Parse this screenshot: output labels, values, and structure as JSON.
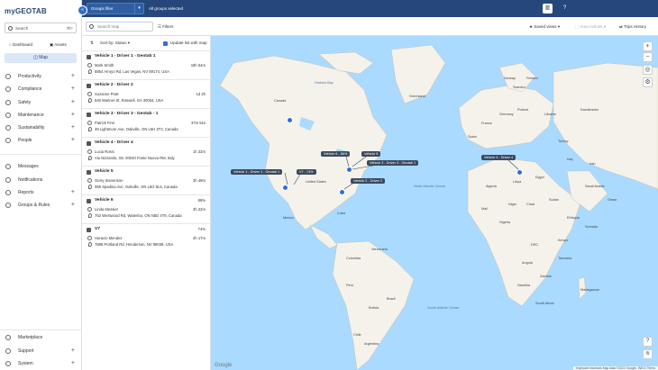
{
  "app": {
    "logo_my": "my",
    "logo_geotab": "GEOTAB"
  },
  "sidebar": {
    "search_placeholder": "Search",
    "search_shortcut": "⌘F",
    "dashboard": "Dashboard",
    "assets": "Assets",
    "map": "Map",
    "nav": [
      "Productivity",
      "Compliance",
      "Safety",
      "Maintenance",
      "Sustainability",
      "People"
    ],
    "nav2": [
      "Messages",
      "Notifications",
      "Reports",
      "Groups & Rules"
    ],
    "bottom": [
      "Marketplace",
      "Support",
      "System"
    ]
  },
  "topbar": {
    "group_filter": "Groups filter",
    "all_groups": "All groups selected"
  },
  "toolbar": {
    "search_placeholder": "Search map",
    "filters": "Filters",
    "saved_views": "Saved views",
    "area_actions": "Area Actions",
    "trips_history": "Trips History"
  },
  "list": {
    "sort_by": "Sort by:",
    "sort_value": "Status",
    "update_label": "Update list with map",
    "vehicles": [
      {
        "name": "Vehicle 1 - Driver 1 - Geotab 1",
        "driver": "Mark Smith",
        "address": "6854 Arroyo Rd, Las Vegas, NV 89174, USA",
        "time": "18h 54m"
      },
      {
        "name": "Vehicle 2 - Driver 2",
        "driver": "Suzanne Pratt",
        "address": "540 Mariner St, Roswell, GA 30054, USA",
        "time": "1d 2h"
      },
      {
        "name": "Vehicle 3 - Driver 3 - Geotab - 1",
        "driver": "Patrick Finn",
        "address": "39 Lightmore Ave, Oakville, ON L6H 4T3, Canada",
        "time": "37m 51s"
      },
      {
        "name": "Vehicle 4 - Driver 4",
        "driver": "Lucia Rossi",
        "address": "Via Nizzanito, Str, 00040 Fonte Nuova RM, Italy",
        "time": "1h 32m"
      },
      {
        "name": "Vehicle 5",
        "driver": "Gerry Stevenson",
        "address": "066 Spadina Ave, Oakville, ON L6G 5L5, Canada",
        "time": "3h 49m"
      },
      {
        "name": "Vehicle 6",
        "driver": "Linda Messier",
        "address": "753 Westwood Rd, Waterloo, ON N5D 4T9, Canada",
        "time": "3h 22m",
        "pct": "86%"
      },
      {
        "name": "V7",
        "driver": "Horacio Mendez",
        "address": "7898 Portland Rd, Henderson, NV 89039, USA",
        "time": "4h 17m",
        "pct": "74%"
      }
    ]
  },
  "map": {
    "labels": [
      "Vehicle 6 - 86%",
      "Vehicle 5",
      "Vehicle 1 - Driver 1 - Geotab 1",
      "V7 - 74%",
      "Vehicle 3 - Driver 3 - Geotab 1",
      "Vehicle 2 - Driver 2",
      "Vehicle 4 - Driver 4"
    ],
    "places": [
      "Greenland",
      "Canada",
      "United States",
      "Mexico",
      "Venezuela",
      "Colombia",
      "Peru",
      "Brazil",
      "Bolivia",
      "Chile",
      "Argentina",
      "Kazakhstan",
      "Iran",
      "Egypt",
      "Libya",
      "Algeria",
      "Mali",
      "Niger",
      "Chad",
      "Sudan",
      "Ethiopia",
      "Nigeria",
      "Kenya",
      "Tanzania",
      "Angola",
      "Namibia",
      "South Africa",
      "Saudi Arabia",
      "Turkey",
      "Spain",
      "Ukraine",
      "Sweden",
      "Norway",
      "Finland",
      "Poland",
      "France",
      "Germany",
      "Iraq",
      "DRC",
      "Madagascar",
      "Oman",
      "Zambia",
      "Somalia",
      "Cuba"
    ],
    "seas": [
      "North Atlantic Ocean",
      "South Atlantic Ocean",
      "Hudson Bay"
    ],
    "attribution": "Keyboard shortcuts   Map data ©2024 Google, INEGI   Terms",
    "google": "Google"
  }
}
